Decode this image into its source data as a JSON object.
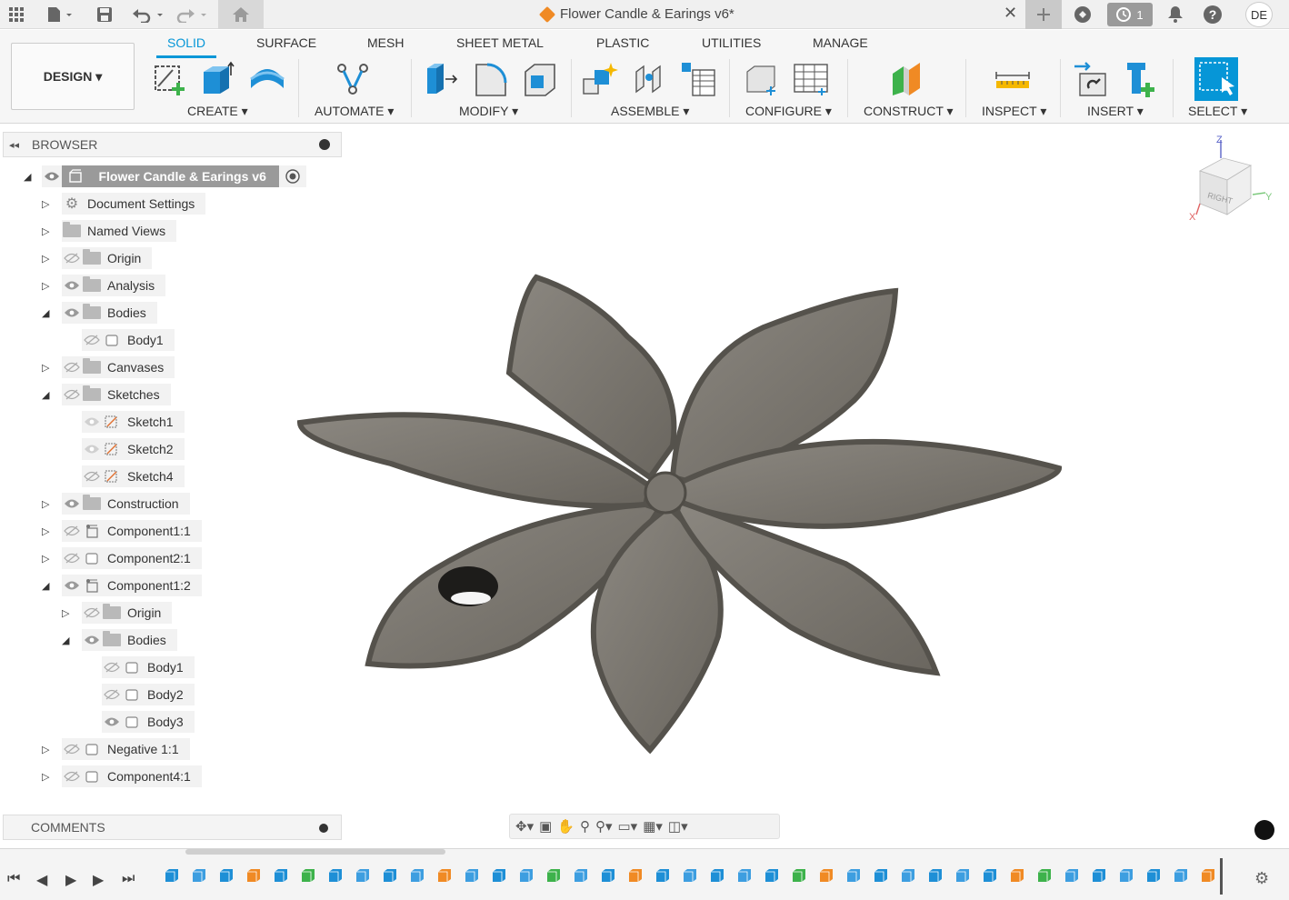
{
  "window": {
    "title": "Flower Candle & Earings v6*",
    "job_count": "1",
    "user_initials": "DE"
  },
  "ribbon": {
    "workspace": "DESIGN ▾",
    "tabs": [
      "SOLID",
      "SURFACE",
      "MESH",
      "SHEET METAL",
      "PLASTIC",
      "UTILITIES",
      "MANAGE"
    ],
    "active_tab": "SOLID",
    "groups": [
      "CREATE ▾",
      "AUTOMATE ▾",
      "MODIFY ▾",
      "ASSEMBLE ▾",
      "CONFIGURE ▾",
      "CONSTRUCT ▾",
      "INSPECT ▾",
      "INSERT ▾",
      "SELECT ▾"
    ]
  },
  "browser": {
    "title": "BROWSER",
    "root": "Flower Candle & Earings v6",
    "items": [
      {
        "label": "Document Settings",
        "icon": "gear-icon",
        "eye": "none",
        "expand": "collapsed"
      },
      {
        "label": "Named Views",
        "icon": "folder-icon",
        "eye": "none",
        "expand": "collapsed"
      },
      {
        "label": "Origin",
        "icon": "folder-icon",
        "eye": "hidden",
        "expand": "collapsed"
      },
      {
        "label": "Analysis",
        "icon": "folder-icon",
        "eye": "visible",
        "expand": "collapsed"
      },
      {
        "label": "Bodies",
        "icon": "folder-icon",
        "eye": "visible",
        "expand": "expanded"
      },
      {
        "label": "Body1",
        "icon": "body-icon",
        "eye": "hidden",
        "expand": "none"
      },
      {
        "label": "Canvases",
        "icon": "folder-icon",
        "eye": "hidden",
        "expand": "collapsed"
      },
      {
        "label": "Sketches",
        "icon": "folder-icon",
        "eye": "hidden",
        "expand": "expanded"
      },
      {
        "label": "Sketch1",
        "icon": "sketch-icon",
        "eye": "dim",
        "expand": "none"
      },
      {
        "label": "Sketch2",
        "icon": "sketch-icon",
        "eye": "dim",
        "expand": "none"
      },
      {
        "label": "Sketch4",
        "icon": "sketch-icon",
        "eye": "hidden",
        "expand": "none"
      },
      {
        "label": "Construction",
        "icon": "folder-icon",
        "eye": "visible",
        "expand": "collapsed"
      },
      {
        "label": "Component1:1",
        "icon": "component-icon",
        "eye": "hidden",
        "expand": "collapsed"
      },
      {
        "label": "Component2:1",
        "icon": "body-icon",
        "eye": "hidden",
        "expand": "collapsed"
      },
      {
        "label": "Component1:2",
        "icon": "component-icon",
        "eye": "visible",
        "expand": "expanded"
      },
      {
        "label": "Origin",
        "icon": "folder-icon",
        "eye": "hidden",
        "expand": "collapsed"
      },
      {
        "label": "Bodies",
        "icon": "folder-icon",
        "eye": "visible",
        "expand": "expanded"
      },
      {
        "label": "Body1",
        "icon": "body-icon",
        "eye": "hidden",
        "expand": "none"
      },
      {
        "label": "Body2",
        "icon": "body-icon",
        "eye": "hidden",
        "expand": "none"
      },
      {
        "label": "Body3",
        "icon": "body-icon",
        "eye": "visible",
        "expand": "none"
      },
      {
        "label": "Negative 1:1",
        "icon": "body-icon",
        "eye": "hidden",
        "expand": "collapsed"
      },
      {
        "label": "Component4:1",
        "icon": "body-icon",
        "eye": "hidden",
        "expand": "collapsed"
      }
    ]
  },
  "comments": {
    "title": "COMMENTS"
  },
  "viewcube": {
    "face": "RIGHT",
    "axes": [
      "Z",
      "Y",
      "X"
    ]
  },
  "colors": {
    "accent": "#0696d7",
    "model": "#7c7870",
    "panel": "#f4f4f4"
  }
}
